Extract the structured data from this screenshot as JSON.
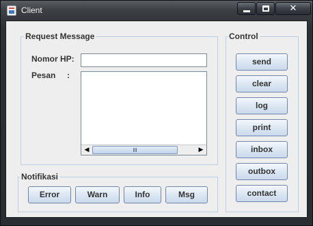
{
  "window": {
    "title": "Client"
  },
  "request": {
    "group_title": "Request Message",
    "phone_label": "Nomor HP:",
    "phone_value": "",
    "message_label": "Pesan     :",
    "message_value": ""
  },
  "notif": {
    "group_title": "Notifikasi",
    "buttons": [
      "Error",
      "Warn",
      "Info",
      "Msg"
    ]
  },
  "control": {
    "group_title": "Control",
    "buttons": [
      "send",
      "clear",
      "log",
      "print",
      "inbox",
      "outbox",
      "contact"
    ]
  },
  "icons": {
    "app": "java-app-icon",
    "minimize": "minimize-icon",
    "maximize": "maximize-icon",
    "close": "close-icon",
    "scroll_left": "arrow-left-icon",
    "scroll_right": "arrow-right-icon"
  },
  "colors": {
    "titlebar": "#2d3135",
    "panel": "#eeeeee",
    "group_border": "#b8cfe5",
    "button_border": "#6e87a8"
  }
}
